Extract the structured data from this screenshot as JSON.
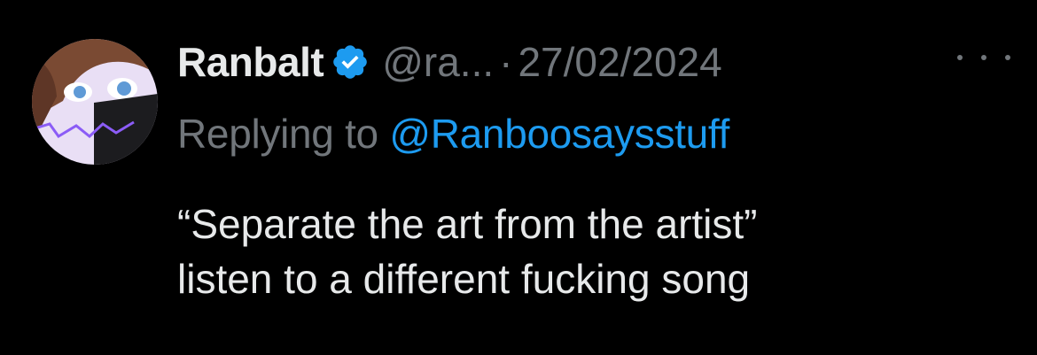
{
  "tweet": {
    "author": {
      "display_name": "Ranbalt",
      "handle": "@ra...",
      "verified": true,
      "verified_color": "#1d9bf0"
    },
    "separator": "·",
    "date": "27/02/2024",
    "reply": {
      "prefix": "Replying to",
      "mention": "@Ranboosaysstuff"
    },
    "text_lines": [
      "“Separate the art from the artist”",
      "listen to a different fucking song"
    ],
    "icons": {
      "verified": "verified-badge-icon",
      "more": "more-options-icon"
    }
  },
  "colors": {
    "background": "#000000",
    "primary_text": "#e7e9ea",
    "secondary_text": "#71767b",
    "accent": "#1d9bf0"
  }
}
